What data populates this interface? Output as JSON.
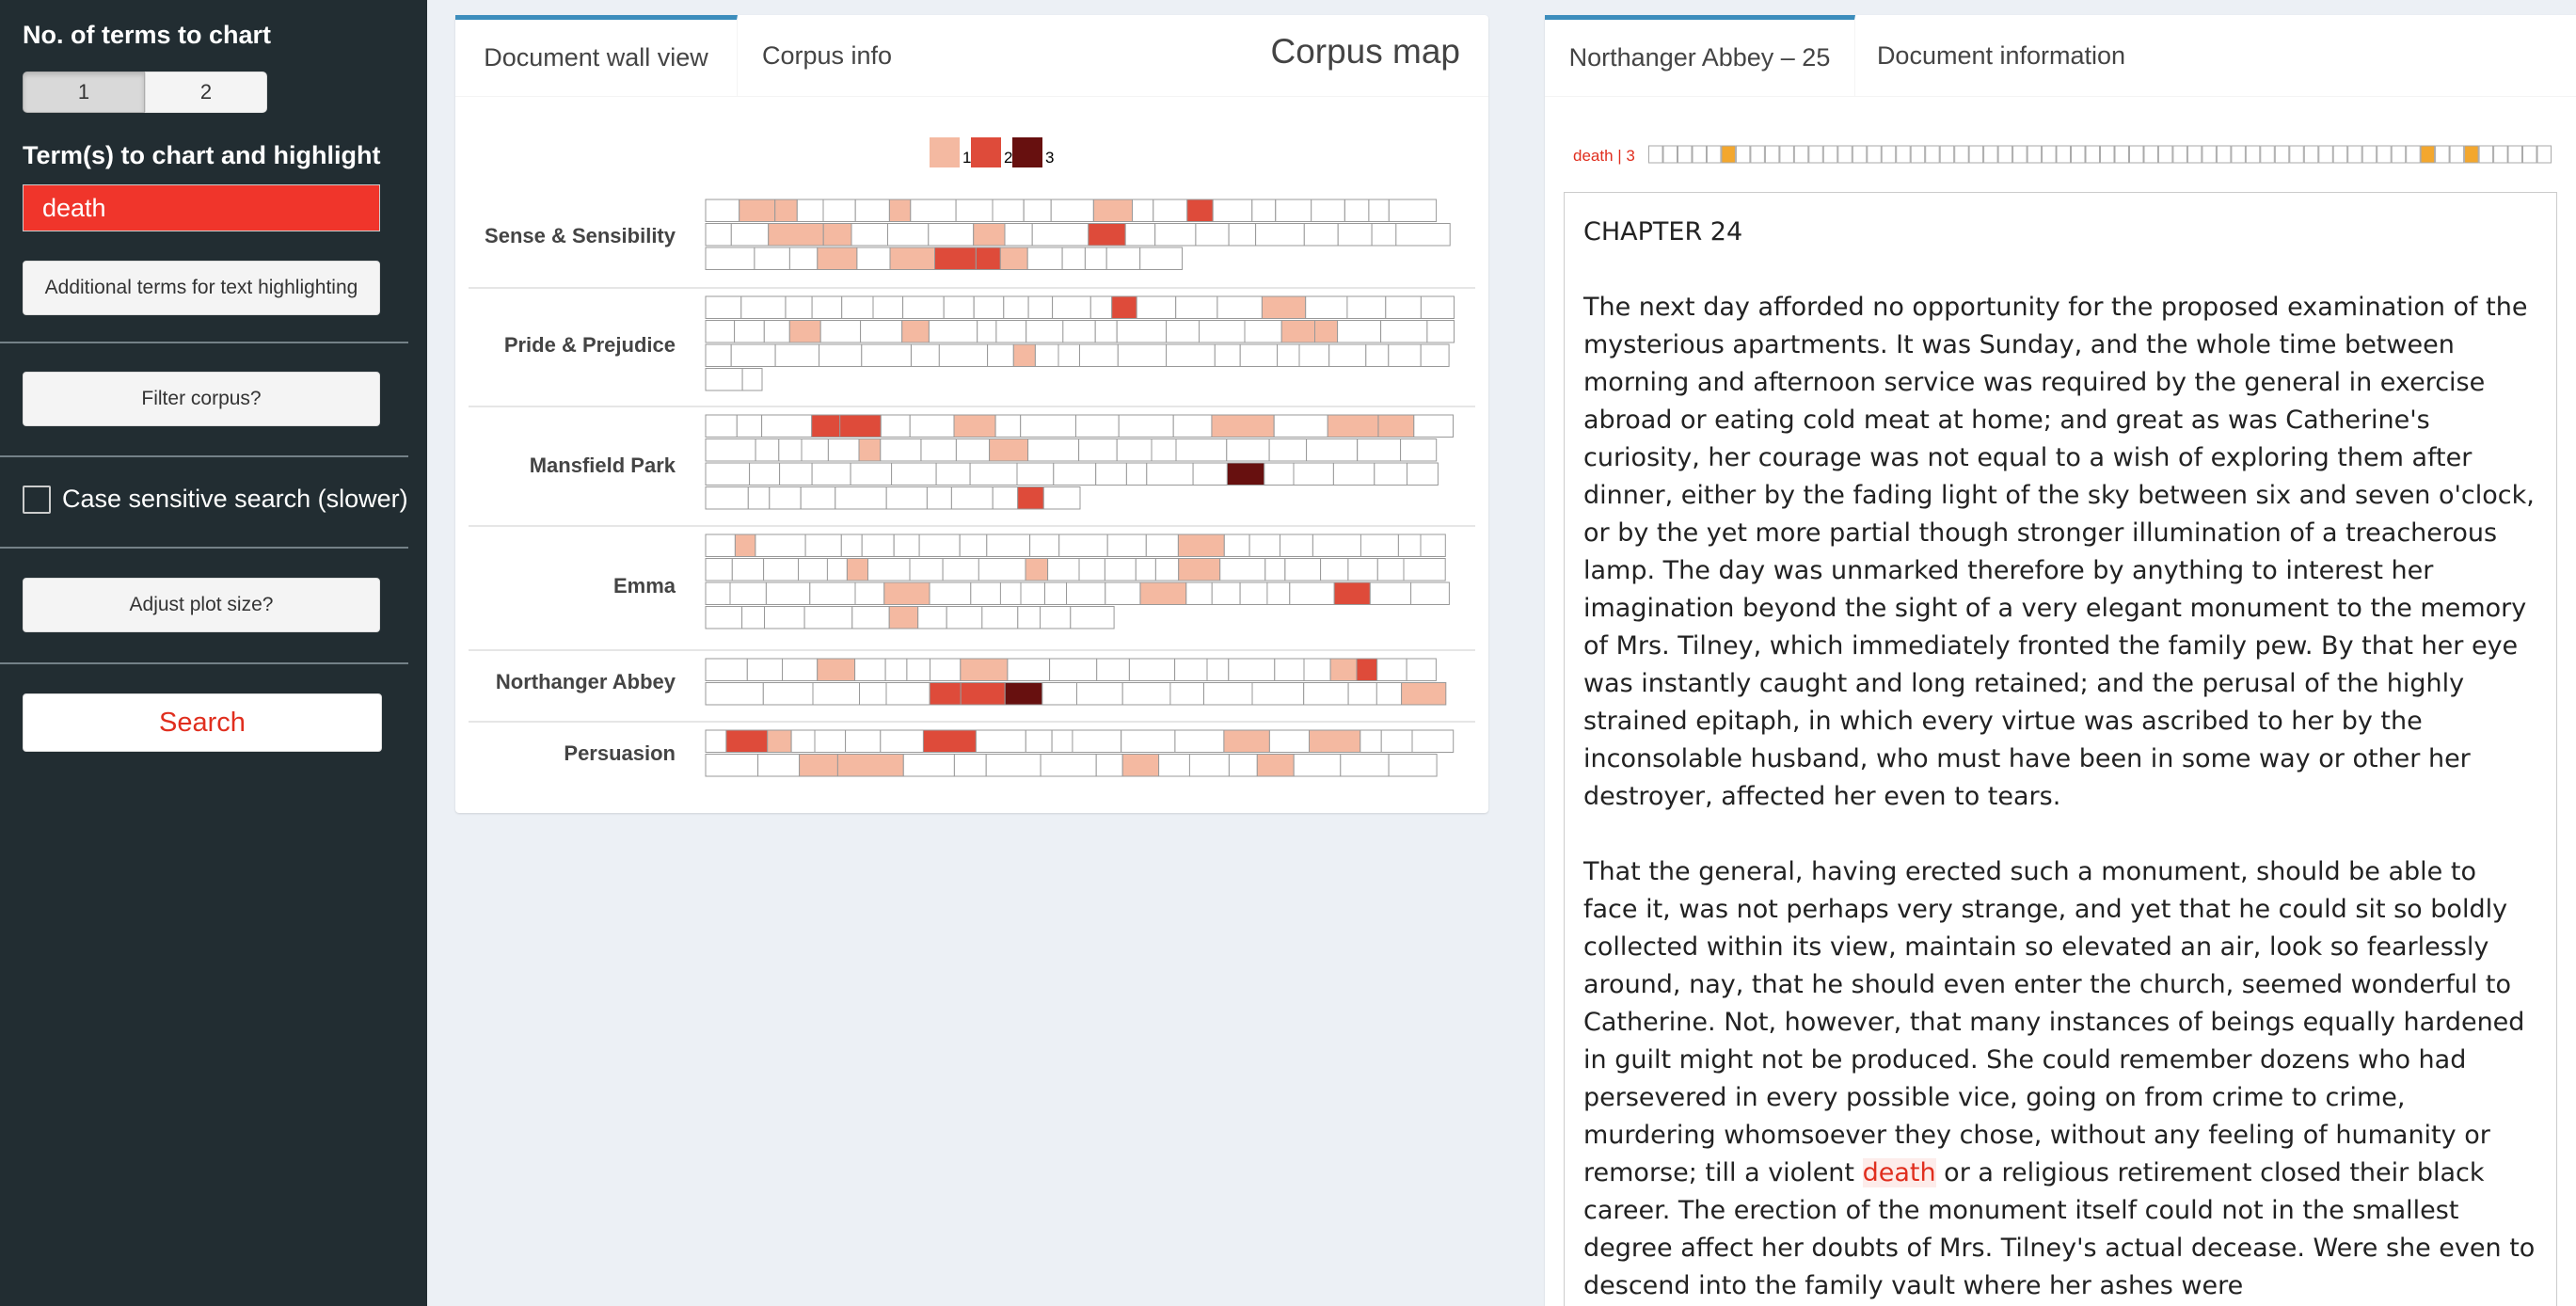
{
  "sidebar": {
    "terms_count_label": "No. of terms to chart",
    "terms_count_options": [
      "1",
      "2"
    ],
    "terms_label": "Term(s) to chart and highlight",
    "term_value": "death",
    "additional_terms_button": "Additional terms for text highlighting",
    "filter_button": "Filter corpus?",
    "case_sensitive_label": "Case sensitive search (slower)",
    "adjust_plot_button": "Adjust plot size?",
    "search_button": "Search"
  },
  "corpus_panel": {
    "tabs": [
      "Document wall view",
      "Corpus info"
    ],
    "title": "Corpus map",
    "legend": [
      "1",
      "2",
      "3"
    ],
    "books": [
      "Sense & Sensibility",
      "Pride & Prejudice",
      "Mansfield Park",
      "Emma",
      "Northanger Abbey",
      "Persuasion"
    ]
  },
  "doc_panel": {
    "tabs": [
      "Northanger Abbey – 25",
      "Document information"
    ],
    "strip_label": "death | 3",
    "chapter": "CHAPTER 24",
    "paragraph1": "The next day afforded no opportunity for the proposed examination of the mysterious apartments. It was Sunday, and the whole time between morning and afternoon service was required by the general in exercise abroad or eating cold meat at home; and great as was Catherine's curiosity, her courage was not equal to a wish of exploring them after dinner, either by the fading light of the sky between six and seven o'clock, or by the yet more partial though stronger illumination of a treacherous lamp. The day was unmarked therefore by anything to interest her imagination beyond the sight of a very elegant monument to the memory of Mrs. Tilney, which immediately fronted the family pew. By that her eye was instantly caught and long retained; and the perusal of the highly strained epitaph, in which every virtue was ascribed to her by the inconsolable husband, who must have been in some way or other her destroyer, affected her even to tears.",
    "paragraph2_before": "That the general, having erected such a monument, should be able to face it, was not perhaps very strange, and yet that he could sit so boldly collected within its view, maintain so elevated an air, look so fearlessly around, nay, that he should even enter the church, seemed wonderful to Catherine. Not, however, that many instances of beings equally hardened in guilt might not be produced. She could remember dozens who had persevered in every possible vice, going on from crime to crime, murdering whomsoever they chose, without any feeling of humanity or remorse; till a violent ",
    "paragraph2_highlight": "death",
    "paragraph2_after": " or a religious retirement closed their black career. The erection of the monument itself could not in the smallest degree affect her doubts of Mrs. Tilney's actual decease. Were she even to descend into the family vault where her ashes were"
  },
  "colors": {
    "level1": "#f4b9a1",
    "level2": "#de4b3a",
    "level3": "#67100f",
    "strip_hit": "#f3a72e",
    "accent": "#3c8dbc",
    "sidebar_bg": "#222d32"
  },
  "wall_data": {
    "Sense & Sensibility": [
      {
        "n": 23,
        "hits": {
          "1": 1,
          "2": 1,
          "6": 1,
          "12": 1,
          "15": 2
        }
      },
      {
        "n": 20,
        "hits": {
          "2": 1,
          "3": 1,
          "7": 1,
          "10": 2
        }
      },
      {
        "n": 14,
        "hits": {
          "3": 1,
          "5": 1,
          "6": 2,
          "7": 2,
          "8": 1
        }
      }
    ],
    "Pride & Prejudice": [
      {
        "n": 22,
        "hits": {
          "13": 2,
          "17": 1
        }
      },
      {
        "n": 22,
        "hits": {
          "3": 1,
          "6": 1,
          "17": 1,
          "18": 1
        }
      },
      {
        "n": 22,
        "hits": {
          "8": 1
        }
      },
      {
        "n": 2,
        "hits": {}
      }
    ],
    "Mansfield Park": [
      {
        "n": 18,
        "hits": {
          "3": 2,
          "4": 2,
          "7": 1,
          "13": 1,
          "15": 1,
          "16": 1
        }
      },
      {
        "n": 20,
        "hits": {
          "5": 1,
          "9": 1
        }
      },
      {
        "n": 20,
        "hits": {
          "14": 3
        }
      },
      {
        "n": 11,
        "hits": {
          "9": 2
        }
      }
    ],
    "Emma": [
      {
        "n": 22,
        "hits": {
          "1": 1,
          "14": 1
        }
      },
      {
        "n": 24,
        "hits": {
          "5": 1,
          "10": 1,
          "16": 1
        }
      },
      {
        "n": 22,
        "hits": {
          "5": 1,
          "13": 1,
          "19": 2
        }
      },
      {
        "n": 12,
        "hits": {
          "5": 1
        }
      }
    ],
    "Northanger Abbey": [
      {
        "n": 22,
        "hits": {
          "3": 1,
          "8": 1,
          "18": 1,
          "19": 2
        }
      },
      {
        "n": 18,
        "hits": {
          "5": 2,
          "6": 2,
          "7": 3,
          "17": 1
        }
      }
    ],
    "Persuasion": [
      {
        "n": 20,
        "hits": {
          "1": 2,
          "2": 1,
          "7": 2,
          "14": 1,
          "16": 1
        }
      },
      {
        "n": 17,
        "hits": {
          "2": 1,
          "3": 1,
          "9": 1,
          "13": 1
        }
      }
    ]
  },
  "doc_strip": {
    "n": 62,
    "hits": [
      5,
      53,
      56
    ]
  }
}
